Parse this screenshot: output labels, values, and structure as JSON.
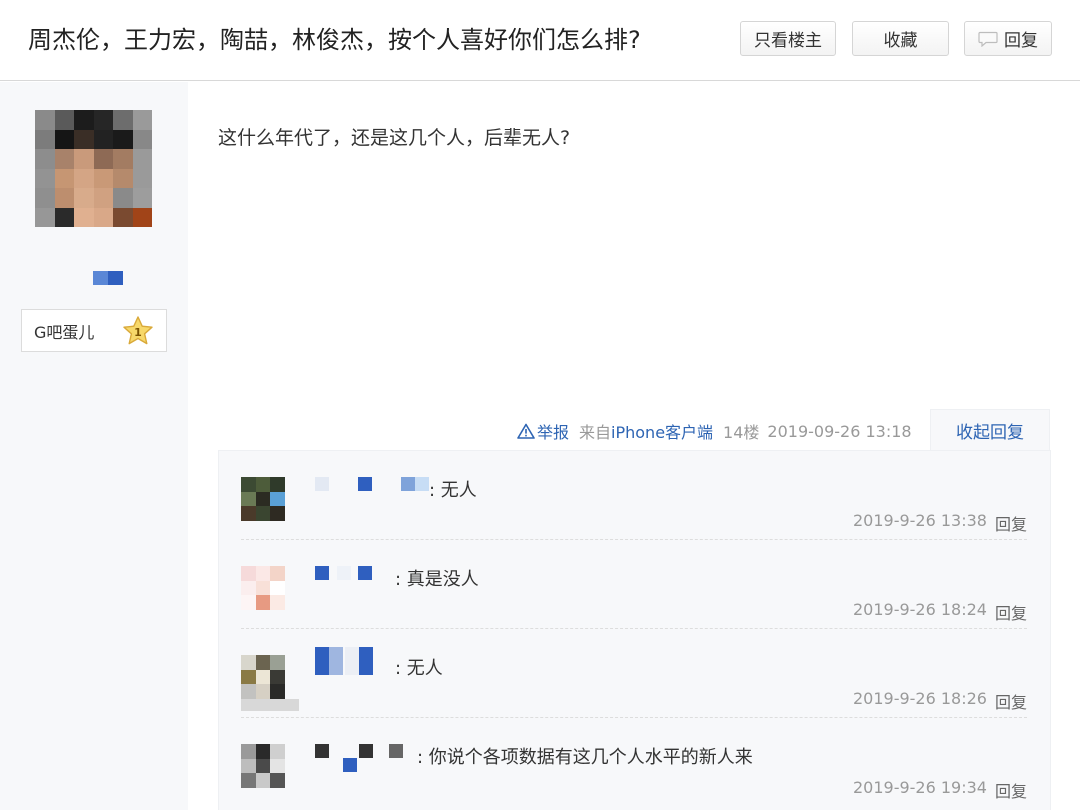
{
  "thread": {
    "title": "周杰伦，王力宏，陶喆，林俊杰，按个人喜好你们怎么排?",
    "buttons": {
      "only_op": "只看楼主",
      "favorite": "收藏",
      "reply": "回复"
    }
  },
  "author": {
    "badge_label": "G吧蛋儿",
    "level": "1"
  },
  "post": {
    "content": "这什么年代了，还是这几个人，后辈无人?",
    "report": "举报",
    "source_prefix": "来自",
    "device": "iPhone客户端",
    "floor": "14楼",
    "time": "2019-09-26 13:18",
    "collapse": "收起回复"
  },
  "sub_replies": [
    {
      "text": ": 无人",
      "time": "2019-9-26 13:38",
      "reply": "回复"
    },
    {
      "text": ": 真是没人",
      "time": "2019-9-26 18:24",
      "reply": "回复"
    },
    {
      "text": ": 无人",
      "time": "2019-9-26 18:26",
      "reply": "回复"
    },
    {
      "text": ": 你说个各项数据有这几个人水平的新人来",
      "time": "2019-9-26 19:34",
      "reply": "回复"
    }
  ]
}
